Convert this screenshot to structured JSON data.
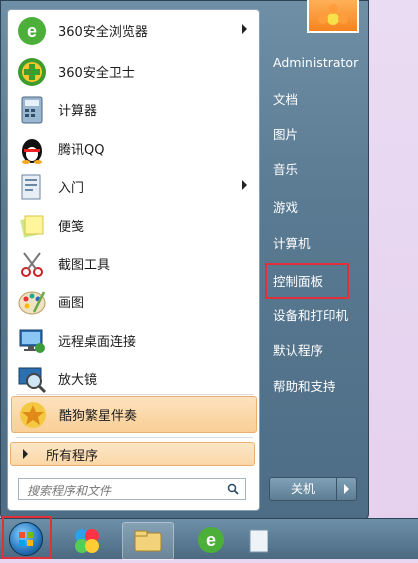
{
  "left_items": [
    {
      "label": "360安全浏览器",
      "icon": "360-browser-icon",
      "has_submenu": true
    },
    {
      "label": "360安全卫士",
      "icon": "360-safeguard-icon",
      "has_submenu": false
    },
    {
      "label": "计算器",
      "icon": "calculator-icon",
      "has_submenu": false
    },
    {
      "label": "腾讯QQ",
      "icon": "qq-penguin-icon",
      "has_submenu": false
    },
    {
      "label": "入门",
      "icon": "getting-started-icon",
      "has_submenu": true
    },
    {
      "label": "便笺",
      "icon": "sticky-notes-icon",
      "has_submenu": false
    },
    {
      "label": "截图工具",
      "icon": "snipping-tool-icon",
      "has_submenu": false
    },
    {
      "label": "画图",
      "icon": "paint-icon",
      "has_submenu": false
    },
    {
      "label": "远程桌面连接",
      "icon": "remote-desktop-icon",
      "has_submenu": false
    },
    {
      "label": "放大镜",
      "icon": "magnifier-icon",
      "has_submenu": false
    },
    {
      "label": "酷狗繁星伴奏",
      "icon": "kugou-icon",
      "has_submenu": false,
      "highlighted": true
    }
  ],
  "all_programs": "所有程序",
  "search": {
    "placeholder": "搜索程序和文件"
  },
  "right_items": [
    "Administrator",
    "文档",
    "图片",
    "音乐",
    "游戏",
    "计算机",
    "控制面板",
    "设备和打印机",
    "默认程序",
    "帮助和支持"
  ],
  "shutdown_label": "关机",
  "highlight_color": "#e0313b"
}
